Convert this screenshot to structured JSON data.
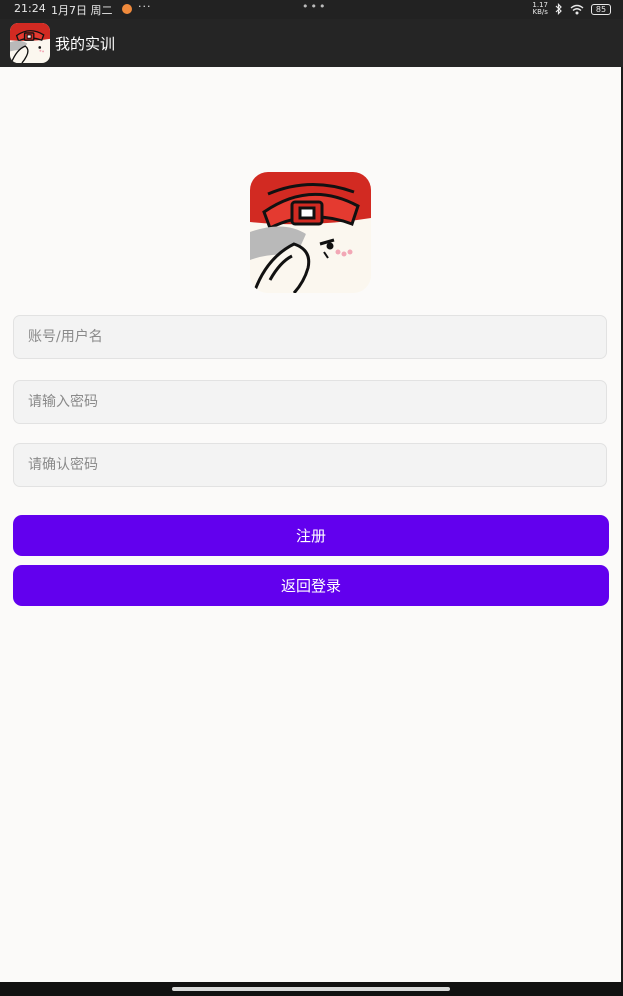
{
  "status_bar": {
    "time": "21:24",
    "date": "1月7日 周二",
    "more": "···",
    "center_dots": "•••",
    "net_speed_top": "1.17",
    "net_speed_bottom": "KB/s",
    "battery": "85"
  },
  "app_bar": {
    "title": "我的实训",
    "icon": "app-logo-icon"
  },
  "form": {
    "username_placeholder": "账号/用户名",
    "password_placeholder": "请输入密码",
    "confirm_placeholder": "请确认密码",
    "register_label": "注册",
    "back_login_label": "返回登录"
  },
  "colors": {
    "primary": "#6200ee",
    "app_bar": "#252525",
    "background": "#fbfaf9",
    "logo_red": "#d32f2f"
  }
}
